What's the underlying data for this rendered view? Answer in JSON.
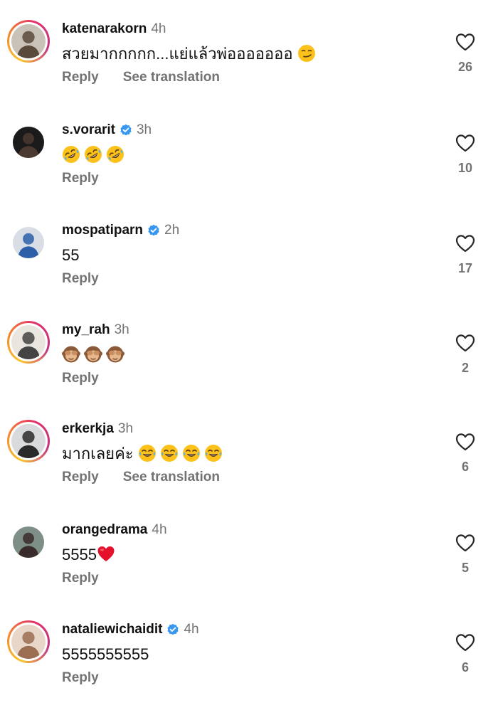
{
  "comments": [
    {
      "username": "katenarakorn",
      "time": "4h",
      "verified": false,
      "ring": true,
      "text": "สวยมากกกกก...แย่แล้วพ่อออออออ",
      "emojis": [
        "smirk"
      ],
      "reply": "Reply",
      "translate": "See translation",
      "likes": "26"
    },
    {
      "username": "s.vorarit",
      "time": "3h",
      "verified": true,
      "ring": false,
      "text": "",
      "emojis": [
        "rofl",
        "rofl",
        "rofl"
      ],
      "reply": "Reply",
      "translate": "",
      "likes": "10"
    },
    {
      "username": "mospatiparn",
      "time": "2h",
      "verified": true,
      "ring": false,
      "text": "55",
      "emojis": [],
      "reply": "Reply",
      "translate": "",
      "likes": "17"
    },
    {
      "username": "my_rah",
      "time": "3h",
      "verified": false,
      "ring": true,
      "text": "",
      "emojis": [
        "see-no-evil",
        "see-no-evil",
        "see-no-evil"
      ],
      "reply": "Reply",
      "translate": "",
      "likes": "2"
    },
    {
      "username": "erkerkja",
      "time": "3h",
      "verified": false,
      "ring": true,
      "text": "มากเลยค่ะ",
      "emojis": [
        "joy",
        "joy",
        "joy",
        "joy"
      ],
      "reply": "Reply",
      "translate": "See translation",
      "likes": "6"
    },
    {
      "username": "orangedrama",
      "time": "4h",
      "verified": false,
      "ring": false,
      "text": "5555",
      "emojis": [
        "red-heart"
      ],
      "reply": "Reply",
      "translate": "",
      "likes": "5"
    },
    {
      "username": "nataliewichaidit",
      "time": "4h",
      "verified": true,
      "ring": true,
      "text": "5555555555",
      "emojis": [],
      "reply": "Reply",
      "translate": "",
      "likes": "6"
    }
  ],
  "icons": {
    "like": "heart-outline-icon",
    "verified": "verified-badge-icon"
  },
  "colors": {
    "secondary_text": "#737373",
    "verified_blue": "#3897f0",
    "story_ring": [
      "#f9c430",
      "#e1306c",
      "#c13584"
    ]
  }
}
